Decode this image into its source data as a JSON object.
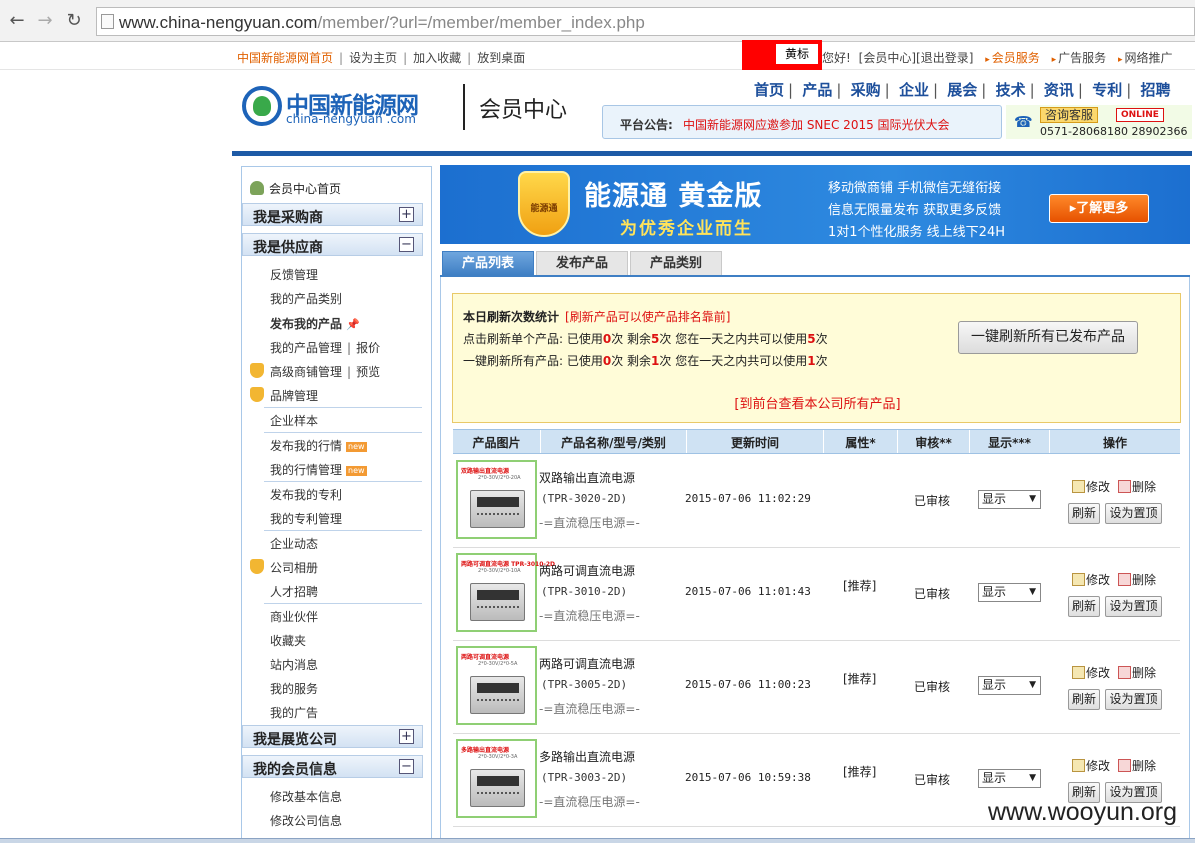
{
  "browser": {
    "url_main": "www.china-nengyuan.com",
    "url_path": "/member/?url=/member/member_index.php"
  },
  "toplinks": {
    "left": [
      "中国新能源网首页",
      "设为主页",
      "加入收藏",
      "放到桌面"
    ],
    "username": "黄标",
    "greeting": "您好!",
    "member_link": "[会员中心]",
    "logout_link": "[退出登录]",
    "right": [
      "会员服务",
      "广告服务",
      "网络推广"
    ]
  },
  "header": {
    "logo_cn": "中国新能源网",
    "logo_en": "china-nengyuan .com",
    "section_title": "会员中心",
    "nav": [
      "首页",
      "产品",
      "采购",
      "企业",
      "展会",
      "技术",
      "资讯",
      "专利",
      "招聘"
    ],
    "notice_label": "平台公告:",
    "notice_text": "中国新能源网应邀参加 SNEC 2015 国际光伏大会",
    "service_label": "咨询客服",
    "online_label": "ONLINE",
    "phone": "0571-28068180 28902366"
  },
  "sidebar": {
    "home": "会员中心首页",
    "sections": {
      "buyer": {
        "title": "我是采购商",
        "toggle": "+"
      },
      "supplier": {
        "title": "我是供应商",
        "toggle": "−"
      },
      "exhibitor": {
        "title": "我是展览公司",
        "toggle": "+"
      },
      "member_info": {
        "title": "我的会员信息",
        "toggle": "−"
      }
    },
    "items": {
      "feedback": "反馈管理",
      "my_categories": "我的产品类别",
      "publish_product": "发布我的产品",
      "product_manage": "我的产品管理",
      "quote": "报价",
      "shop_manage": "高级商铺管理",
      "preview": "预览",
      "brand_manage": "品牌管理",
      "sample": "企业样本",
      "publish_market": "发布我的行情",
      "market_manage": "我的行情管理",
      "publish_patent": "发布我的专利",
      "patent_manage": "我的专利管理",
      "news": "企业动态",
      "album": "公司相册",
      "recruit": "人才招聘",
      "partners": "商业伙伴",
      "favorites": "收藏夹",
      "messages": "站内消息",
      "my_services": "我的服务",
      "my_ads": "我的广告",
      "edit_basic": "修改基本信息",
      "edit_company": "修改公司信息",
      "new_badge": "new"
    }
  },
  "banner": {
    "shield_label": "能源通",
    "title": "能源通 黄金版",
    "slogan": "为优秀企业而生",
    "features": [
      "移动微商铺  手机微信无缝衔接",
      "信息无限量发布  获取更多反馈",
      "1对1个性化服务  线上线下24H"
    ],
    "more_button": "▸了解更多"
  },
  "tabs": [
    "产品列表",
    "发布产品",
    "产品类别"
  ],
  "stats": {
    "title": "本日刷新次数统计",
    "hint": "[刷新产品可以使产品排名靠前]",
    "single": {
      "prefix": "点击刷新单个产品: 已使用",
      "used": "0",
      "mid": "次 剩余",
      "left": "5",
      "suffix": "次 您在一天之内共可以使用",
      "total": "5",
      "end": "次"
    },
    "all": {
      "prefix": "一键刷新所有产品: 已使用",
      "used": "0",
      "mid": "次 剩余",
      "left": "1",
      "suffix": "次 您在一天之内共可以使用",
      "total": "1",
      "end": "次"
    },
    "refresh_all_button": "一键刷新所有已发布产品",
    "view_all_link": "[到前台查看本公司所有产品]"
  },
  "table": {
    "headers": [
      "产品图片",
      "产品名称/型号/类别",
      "更新时间",
      "属性*",
      "审核**",
      "显示***",
      "操作"
    ],
    "rows": [
      {
        "thumb_caption": "双路输出直流电源",
        "thumb_spec": "2*0-30V/2*0-20A",
        "name": "双路输出直流电源",
        "model": "(TPR-3020-2D)",
        "category": "-=直流稳压电源=-",
        "time": "2015-07-06 11:02:29",
        "attr": "",
        "audit": "已审核",
        "display": "显示",
        "edit": "修改",
        "delete": "删除",
        "refresh": "刷新",
        "top": "设为置顶"
      },
      {
        "thumb_caption": "两路可调直流电源 TPR-3010-2D",
        "thumb_spec": "2*0-30V/2*0-10A",
        "name": "两路可调直流电源",
        "model": "(TPR-3010-2D)",
        "category": "-=直流稳压电源=-",
        "time": "2015-07-06 11:01:43",
        "attr": "[推荐]",
        "audit": "已审核",
        "display": "显示",
        "edit": "修改",
        "delete": "删除",
        "refresh": "刷新",
        "top": "设为置顶"
      },
      {
        "thumb_caption": "两路可调直流电源",
        "thumb_spec": "2*0-30V/2*0-5A",
        "name": "两路可调直流电源",
        "model": "(TPR-3005-2D)",
        "category": "-=直流稳压电源=-",
        "time": "2015-07-06 11:00:23",
        "attr": "[推荐]",
        "audit": "已审核",
        "display": "显示",
        "edit": "修改",
        "delete": "删除",
        "refresh": "刷新",
        "top": "设为置顶"
      },
      {
        "thumb_caption": "多路输出直流电源",
        "thumb_spec": "2*0-30V/2*0-3A",
        "name": "多路输出直流电源",
        "model": "(TPR-3003-2D)",
        "category": "-=直流稳压电源=-",
        "time": "2015-07-06 10:59:38",
        "attr": "[推荐]",
        "audit": "已审核",
        "display": "显示",
        "edit": "修改",
        "delete": "删除",
        "refresh": "刷新",
        "top": "设为置顶"
      }
    ]
  },
  "watermark": "www.wooyun.org",
  "colors": {
    "brand_blue": "#1d5aa6",
    "accent_orange": "#e06000",
    "alert_red": "#dd1111",
    "redact_box": "#ff0000"
  }
}
